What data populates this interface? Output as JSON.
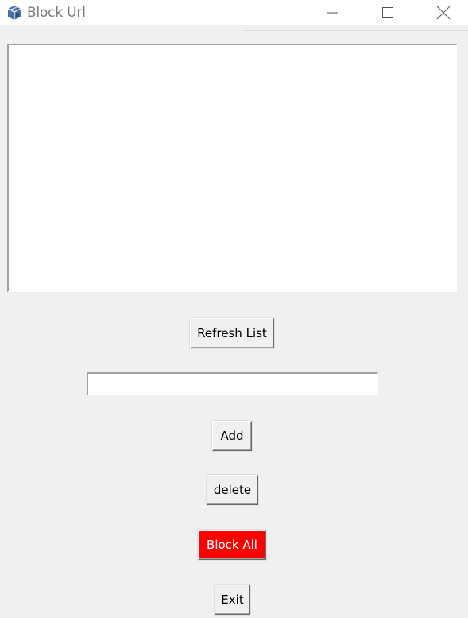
{
  "window": {
    "title": "Block Url",
    "icon": "python-feather-icon",
    "controls": {
      "minimize_icon": "minimize-icon",
      "maximize_icon": "maximize-icon",
      "close_icon": "close-icon"
    }
  },
  "url_list": {
    "items": []
  },
  "buttons": {
    "refresh": "Refresh List",
    "add": "Add",
    "delete": "delete",
    "block_all": "Block All",
    "exit": "Exit"
  },
  "url_entry": {
    "value": "",
    "placeholder": ""
  },
  "colors": {
    "background": "#f0f0f0",
    "block_all_bg": "#ff0000",
    "block_all_fg": "#ffffff"
  }
}
